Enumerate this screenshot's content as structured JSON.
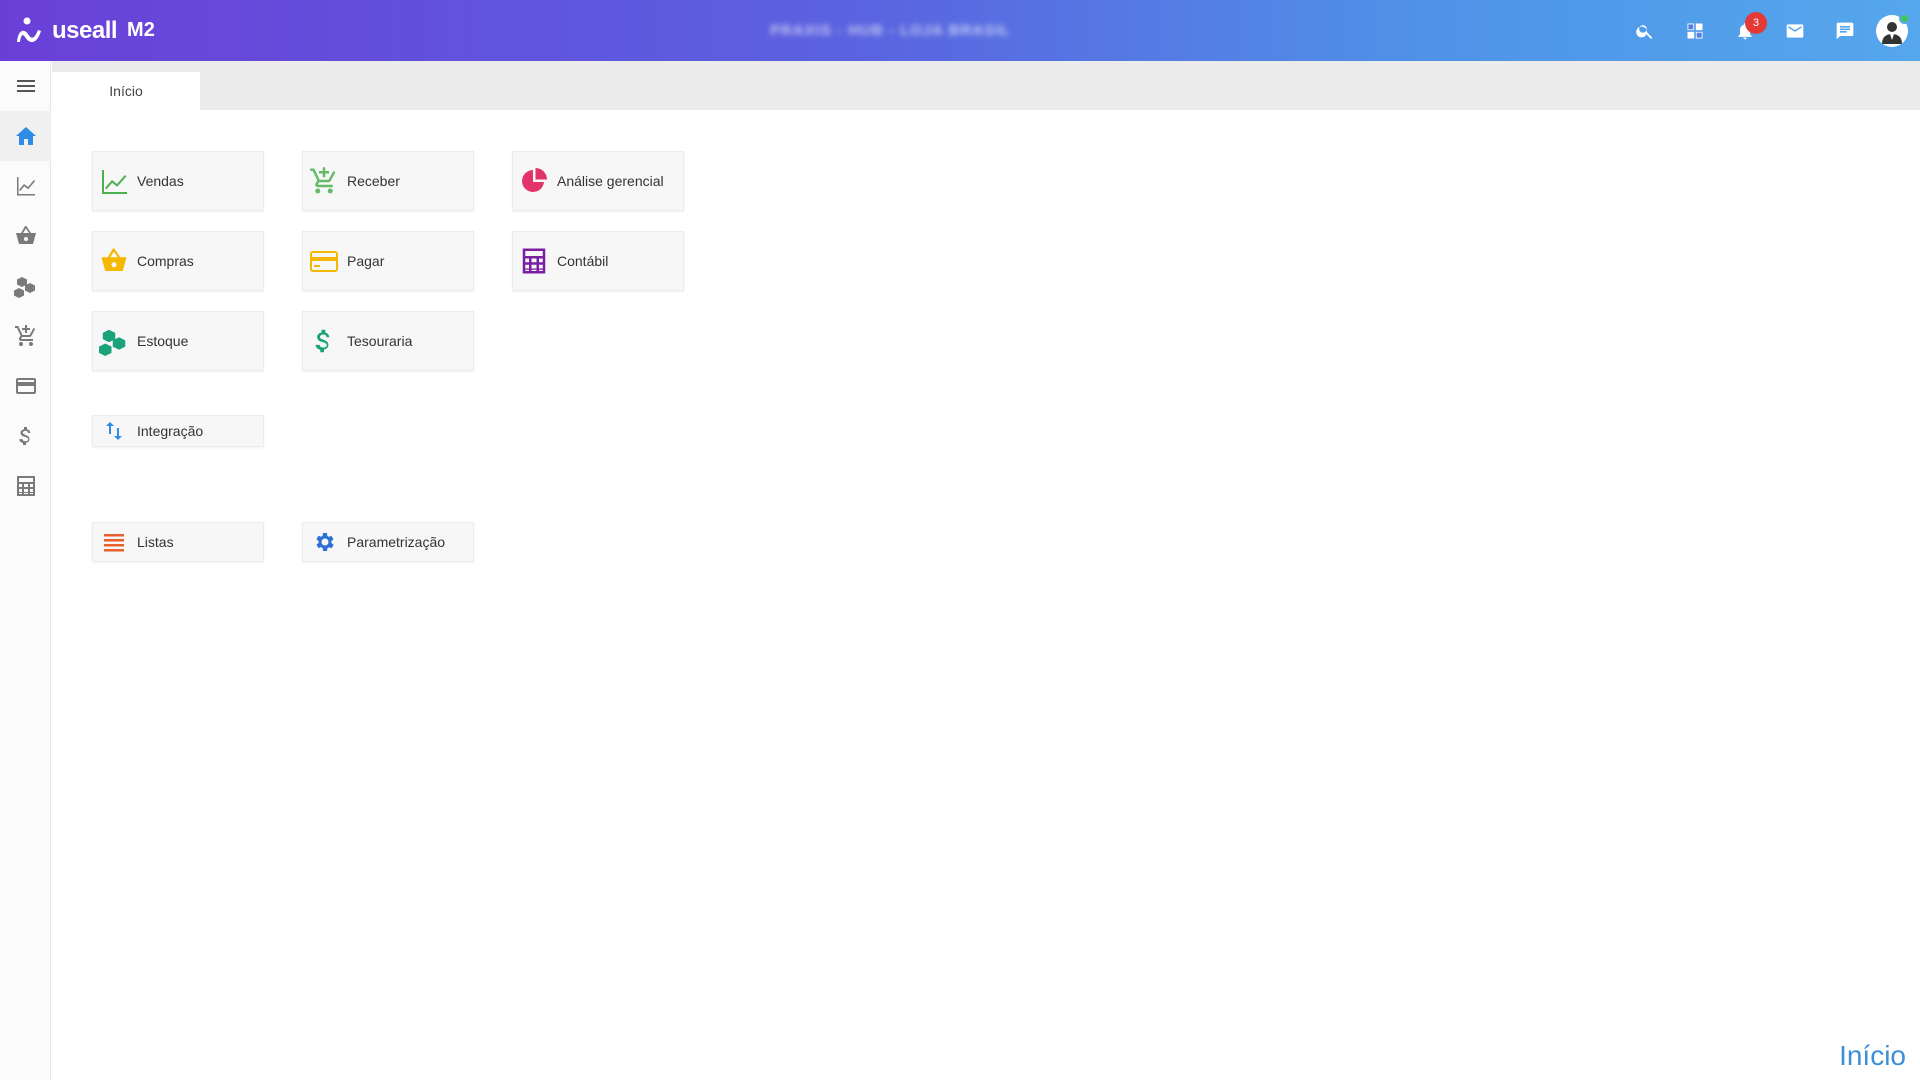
{
  "header": {
    "logo_text": "useall",
    "logo_sub": "M2",
    "company_name": "PRAXIS - HUB - LOJA BRASIL",
    "notification_count": "3",
    "icons": [
      "search-icon",
      "apps-icon",
      "bell-icon",
      "mail-icon",
      "chat-icon",
      "user-avatar"
    ]
  },
  "sidebar": {
    "items": [
      {
        "name": "menu-icon"
      },
      {
        "name": "home-icon"
      },
      {
        "name": "sales-chart-icon"
      },
      {
        "name": "basket-icon"
      },
      {
        "name": "boxes-icon"
      },
      {
        "name": "cart-add-icon"
      },
      {
        "name": "card-icon"
      },
      {
        "name": "dollar-icon"
      },
      {
        "name": "calculator-icon"
      }
    ]
  },
  "tabs": [
    {
      "label": "Início"
    }
  ],
  "tiles": [
    {
      "label": "Vendas",
      "icon": "trend-icon",
      "color": "#4caf50"
    },
    {
      "label": "Receber",
      "icon": "cart-plus-icon",
      "color": "#66bb6a"
    },
    {
      "label": "Análise gerencial",
      "icon": "pie-icon",
      "color": "#e0346a"
    },
    {
      "label": "Compras",
      "icon": "basket-icon",
      "color": "#f5b800"
    },
    {
      "label": "Pagar",
      "icon": "credit-card-icon",
      "color": "#f5b800"
    },
    {
      "label": "Contábil",
      "icon": "calculator-icon",
      "color": "#7b1fa2"
    },
    {
      "label": "Estoque",
      "icon": "boxes-icon",
      "color": "#1aa37a"
    },
    {
      "label": "Tesouraria",
      "icon": "dollar-icon",
      "color": "#1aa37a"
    },
    {
      "label": "Integração",
      "icon": "sync-arrows-icon",
      "color": "#2e8be6"
    },
    {
      "label": "Listas",
      "icon": "list-icon",
      "color": "#e8612c"
    },
    {
      "label": "Parametrização",
      "icon": "gear-icon",
      "color": "#2e6fd6"
    }
  ],
  "footer": {
    "title": "Início"
  }
}
